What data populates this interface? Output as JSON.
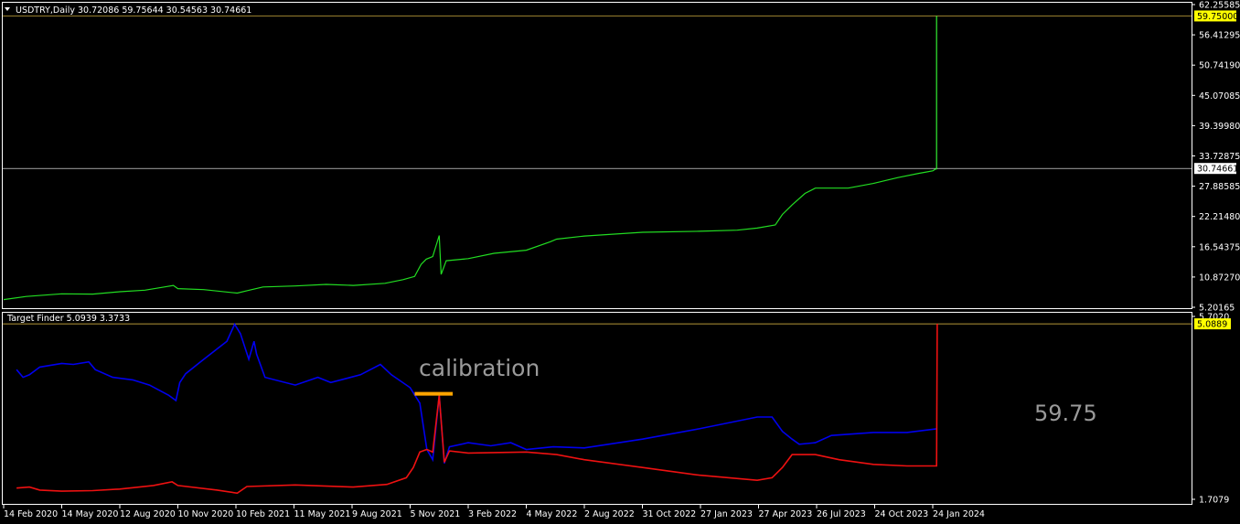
{
  "colors": {
    "background": "#000000",
    "frame": "#ffffff",
    "price_line": "#22dd22",
    "spike_line": "#33ee33",
    "marker_line": "#f0c84a",
    "blue_series": "#0000ee",
    "red_series": "#ee1111",
    "calibration_bar": "#ffa500",
    "annotation_text": "#9a9a9a",
    "price_box": "#ffff00"
  },
  "main_panel": {
    "caption": "USDTRY,Daily  30.72086 59.75644 30.54563 30.74661",
    "menu_icon": "triangle-down-icon"
  },
  "indicator_panel": {
    "caption": "Target Finder 5.0939 3.3733",
    "annotation": "calibration",
    "value_text": "59.75"
  },
  "chart_data": [
    {
      "type": "line",
      "name": "main",
      "series": [
        {
          "values": [
            [
              "2020-02-14",
              5.8
            ],
            [
              "2020-03-20",
              6.4
            ],
            [
              "2020-05-14",
              6.9
            ],
            [
              "2020-07-01",
              6.85
            ],
            [
              "2020-08-12",
              7.3
            ],
            [
              "2020-09-20",
              7.6
            ],
            [
              "2020-10-20",
              8.2
            ],
            [
              "2020-11-03",
              8.5
            ],
            [
              "2020-11-10",
              7.9
            ],
            [
              "2020-12-20",
              7.7
            ],
            [
              "2021-02-10",
              7.05
            ],
            [
              "2021-02-25",
              7.5
            ],
            [
              "2021-03-22",
              8.2
            ],
            [
              "2021-05-11",
              8.4
            ],
            [
              "2021-06-28",
              8.7
            ],
            [
              "2021-08-09",
              8.5
            ],
            [
              "2021-09-27",
              8.9
            ],
            [
              "2021-10-25",
              9.6
            ],
            [
              "2021-11-12",
              10.2
            ],
            [
              "2021-11-22",
              12.5
            ],
            [
              "2021-11-30",
              13.5
            ],
            [
              "2021-12-10",
              14.0
            ],
            [
              "2021-12-20",
              18.0
            ],
            [
              "2021-12-23",
              10.6
            ],
            [
              "2021-12-31",
              13.2
            ],
            [
              "2022-02-03",
              13.6
            ],
            [
              "2022-03-15",
              14.6
            ],
            [
              "2022-05-04",
              15.2
            ],
            [
              "2022-06-10",
              16.8
            ],
            [
              "2022-06-20",
              17.3
            ],
            [
              "2022-08-02",
              17.9
            ],
            [
              "2022-10-31",
              18.6
            ],
            [
              "2023-01-27",
              18.8
            ],
            [
              "2023-03-27",
              19.0
            ],
            [
              "2023-04-27",
              19.4
            ],
            [
              "2023-05-25",
              20.0
            ],
            [
              "2023-06-05",
              22.0
            ],
            [
              "2023-06-20",
              23.8
            ],
            [
              "2023-07-10",
              26.0
            ],
            [
              "2023-07-26",
              27.0
            ],
            [
              "2023-08-20",
              27.0
            ],
            [
              "2023-09-15",
              27.0
            ],
            [
              "2023-10-24",
              27.9
            ],
            [
              "2023-12-01",
              29.0
            ],
            [
              "2024-01-02",
              29.8
            ],
            [
              "2024-01-24",
              30.3
            ],
            [
              "2024-01-30",
              30.75
            ]
          ]
        },
        {
          "values": [
            [
              "2024-01-30",
              30.55
            ],
            [
              "2024-01-30",
              59.75
            ]
          ]
        }
      ],
      "horizontal_lines": [
        59.75,
        30.74661
      ],
      "price_boxes": [
        "59.75000",
        "30.74661"
      ],
      "ylim": [
        4.0,
        62.26
      ],
      "y_ticks": [
        "62.25585",
        "56.41295",
        "50.74190",
        "45.07085",
        "39.39980",
        "33.72875",
        "27.88585",
        "22.21480",
        "16.54375",
        "10.87270",
        "5.20165"
      ],
      "grid": false
    },
    {
      "type": "line",
      "name": "indicator",
      "series": [
        {
          "values": [
            [
              "2020-03-05",
              4.2
            ],
            [
              "2020-03-15",
              4.05
            ],
            [
              "2020-03-25",
              4.1
            ],
            [
              "2020-04-10",
              4.25
            ],
            [
              "2020-05-14",
              4.32
            ],
            [
              "2020-06-01",
              4.3
            ],
            [
              "2020-06-25",
              4.35
            ],
            [
              "2020-07-05",
              4.2
            ],
            [
              "2020-08-01",
              4.05
            ],
            [
              "2020-09-01",
              4.0
            ],
            [
              "2020-09-27",
              3.9
            ],
            [
              "2020-10-27",
              3.7
            ],
            [
              "2020-11-07",
              3.6
            ],
            [
              "2020-11-13",
              3.95
            ],
            [
              "2020-11-22",
              4.12
            ],
            [
              "2020-12-15",
              4.35
            ],
            [
              "2021-01-25",
              4.75
            ],
            [
              "2021-02-06",
              5.08
            ],
            [
              "2021-02-15",
              4.9
            ],
            [
              "2021-02-28",
              4.4
            ],
            [
              "2021-03-08",
              4.75
            ],
            [
              "2021-03-12",
              4.5
            ],
            [
              "2021-03-25",
              4.05
            ],
            [
              "2021-05-11",
              3.9
            ],
            [
              "2021-06-15",
              4.05
            ],
            [
              "2021-07-05",
              3.95
            ],
            [
              "2021-08-20",
              4.1
            ],
            [
              "2021-09-20",
              4.3
            ],
            [
              "2021-10-07",
              4.1
            ],
            [
              "2021-11-05",
              3.85
            ],
            [
              "2021-11-20",
              3.55
            ],
            [
              "2021-12-01",
              2.65
            ],
            [
              "2021-12-10",
              2.45
            ],
            [
              "2021-12-20",
              3.7
            ],
            [
              "2021-12-28",
              2.38
            ],
            [
              "2022-01-05",
              2.7
            ],
            [
              "2022-02-03",
              2.78
            ],
            [
              "2022-03-10",
              2.72
            ],
            [
              "2022-04-10",
              2.78
            ],
            [
              "2022-05-04",
              2.65
            ],
            [
              "2022-06-15",
              2.7
            ],
            [
              "2022-08-02",
              2.68
            ],
            [
              "2022-10-31",
              2.85
            ],
            [
              "2023-01-27",
              3.05
            ],
            [
              "2023-04-27",
              3.28
            ],
            [
              "2023-05-20",
              3.28
            ],
            [
              "2023-06-05",
              3.0
            ],
            [
              "2023-06-20",
              2.85
            ],
            [
              "2023-07-01",
              2.75
            ],
            [
              "2023-07-26",
              2.78
            ],
            [
              "2023-08-20",
              2.92
            ],
            [
              "2023-10-24",
              2.98
            ],
            [
              "2023-12-15",
              2.98
            ],
            [
              "2024-01-30",
              3.05
            ]
          ]
        },
        {
          "values": [
            [
              "2020-03-05",
              1.9
            ],
            [
              "2020-03-25",
              1.92
            ],
            [
              "2020-04-10",
              1.86
            ],
            [
              "2020-05-14",
              1.84
            ],
            [
              "2020-07-01",
              1.85
            ],
            [
              "2020-08-12",
              1.88
            ],
            [
              "2020-10-03",
              1.95
            ],
            [
              "2020-11-01",
              2.02
            ],
            [
              "2020-11-10",
              1.95
            ],
            [
              "2021-01-10",
              1.86
            ],
            [
              "2021-02-10",
              1.8
            ],
            [
              "2021-02-25",
              1.93
            ],
            [
              "2021-05-11",
              1.96
            ],
            [
              "2021-08-09",
              1.92
            ],
            [
              "2021-09-30",
              1.97
            ],
            [
              "2021-10-30",
              2.1
            ],
            [
              "2021-11-10",
              2.3
            ],
            [
              "2021-11-20",
              2.6
            ],
            [
              "2021-12-01",
              2.65
            ],
            [
              "2021-12-10",
              2.6
            ],
            [
              "2021-12-20",
              3.7
            ],
            [
              "2021-12-28",
              2.4
            ],
            [
              "2022-01-05",
              2.62
            ],
            [
              "2022-02-03",
              2.58
            ],
            [
              "2022-05-04",
              2.6
            ],
            [
              "2022-06-20",
              2.55
            ],
            [
              "2022-08-02",
              2.45
            ],
            [
              "2022-10-31",
              2.3
            ],
            [
              "2023-01-27",
              2.15
            ],
            [
              "2023-04-27",
              2.05
            ],
            [
              "2023-05-20",
              2.1
            ],
            [
              "2023-06-05",
              2.3
            ],
            [
              "2023-06-20",
              2.55
            ],
            [
              "2023-07-26",
              2.55
            ],
            [
              "2023-09-01",
              2.45
            ],
            [
              "2023-10-24",
              2.36
            ],
            [
              "2023-12-15",
              2.33
            ],
            [
              "2024-01-30",
              2.33
            ],
            [
              "2024-01-31",
              5.09
            ]
          ]
        }
      ],
      "horizontal_lines": [
        5.0889
      ],
      "price_boxes": [
        "5.0889"
      ],
      "calibration_bar": [
        [
          "2021-11-12",
          3.73
        ],
        [
          "2022-01-10",
          3.73
        ]
      ],
      "ylim": [
        1.7079,
        5.1
      ],
      "y_ticks": [
        "5.7020",
        "1.7079"
      ],
      "grid": false
    }
  ],
  "x_axis_ticks": [
    "14 Feb 2020",
    "14 May 2020",
    "12 Aug 2020",
    "10 Nov 2020",
    "10 Feb 2021",
    "11 May 2021",
    "9 Aug 2021",
    "5 Nov 2021",
    "3 Feb 2022",
    "4 May 2022",
    "2 Aug 2022",
    "31 Oct 2022",
    "27 Jan 2023",
    "27 Apr 2023",
    "26 Jul 2023",
    "24 Oct 2023",
    "24 Jan 2024"
  ]
}
